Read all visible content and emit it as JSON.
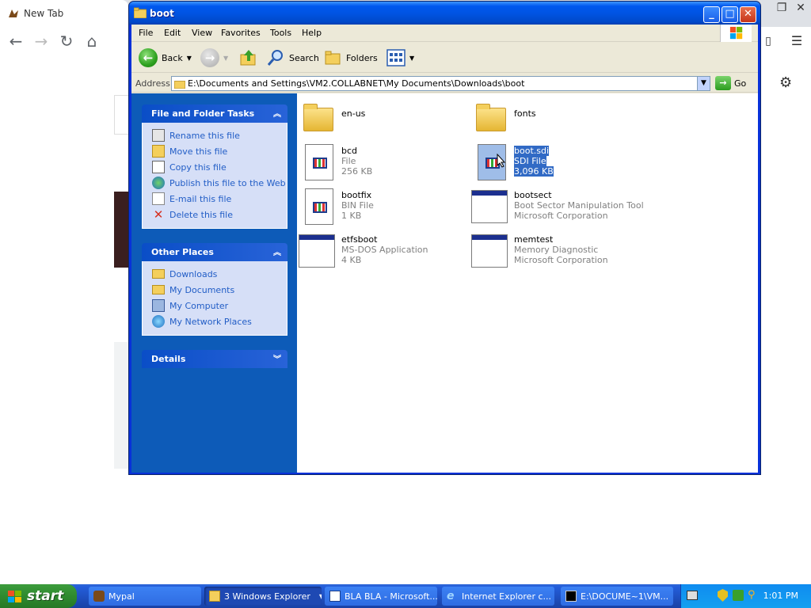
{
  "browser": {
    "tab_title": "New Tab"
  },
  "window": {
    "title": "boot"
  },
  "menu": [
    "File",
    "Edit",
    "View",
    "Favorites",
    "Tools",
    "Help"
  ],
  "toolbar": {
    "back_label": "Back",
    "search_label": "Search",
    "folders_label": "Folders"
  },
  "address": {
    "label": "Address",
    "path": "E:\\Documents and Settings\\VM2.COLLABNET\\My Documents\\Downloads\\boot",
    "go_label": "Go"
  },
  "tasks_panel": {
    "title": "File and Folder Tasks",
    "links": [
      "Rename this file",
      "Move this file",
      "Copy this file",
      "Publish this file to the Web",
      "E-mail this file",
      "Delete this file"
    ]
  },
  "places_panel": {
    "title": "Other Places",
    "links": [
      "Downloads",
      "My Documents",
      "My Computer",
      "My Network Places"
    ]
  },
  "details_panel": {
    "title": "Details"
  },
  "files": [
    {
      "name": "en-us",
      "type": "",
      "size": ""
    },
    {
      "name": "fonts",
      "type": "",
      "size": ""
    },
    {
      "name": "bcd",
      "type": "File",
      "size": "256 KB"
    },
    {
      "name": "boot.sdi",
      "type": "SDI File",
      "size": "3,096 KB"
    },
    {
      "name": "bootfix",
      "type": "BIN File",
      "size": "1 KB"
    },
    {
      "name": "bootsect",
      "type": "Boot Sector Manipulation Tool",
      "size": "Microsoft Corporation"
    },
    {
      "name": "etfsboot",
      "type": "MS-DOS Application",
      "size": "4 KB"
    },
    {
      "name": "memtest",
      "type": "Memory Diagnostic",
      "size": "Microsoft Corporation"
    }
  ],
  "taskbar": {
    "start_label": "start",
    "buttons": [
      "Mypal",
      "3 Windows Explorer",
      "BLA BLA - Microsoft...",
      "Internet Explorer c...",
      "E:\\DOCUME~1\\VM..."
    ],
    "clock": "1:01 PM"
  }
}
